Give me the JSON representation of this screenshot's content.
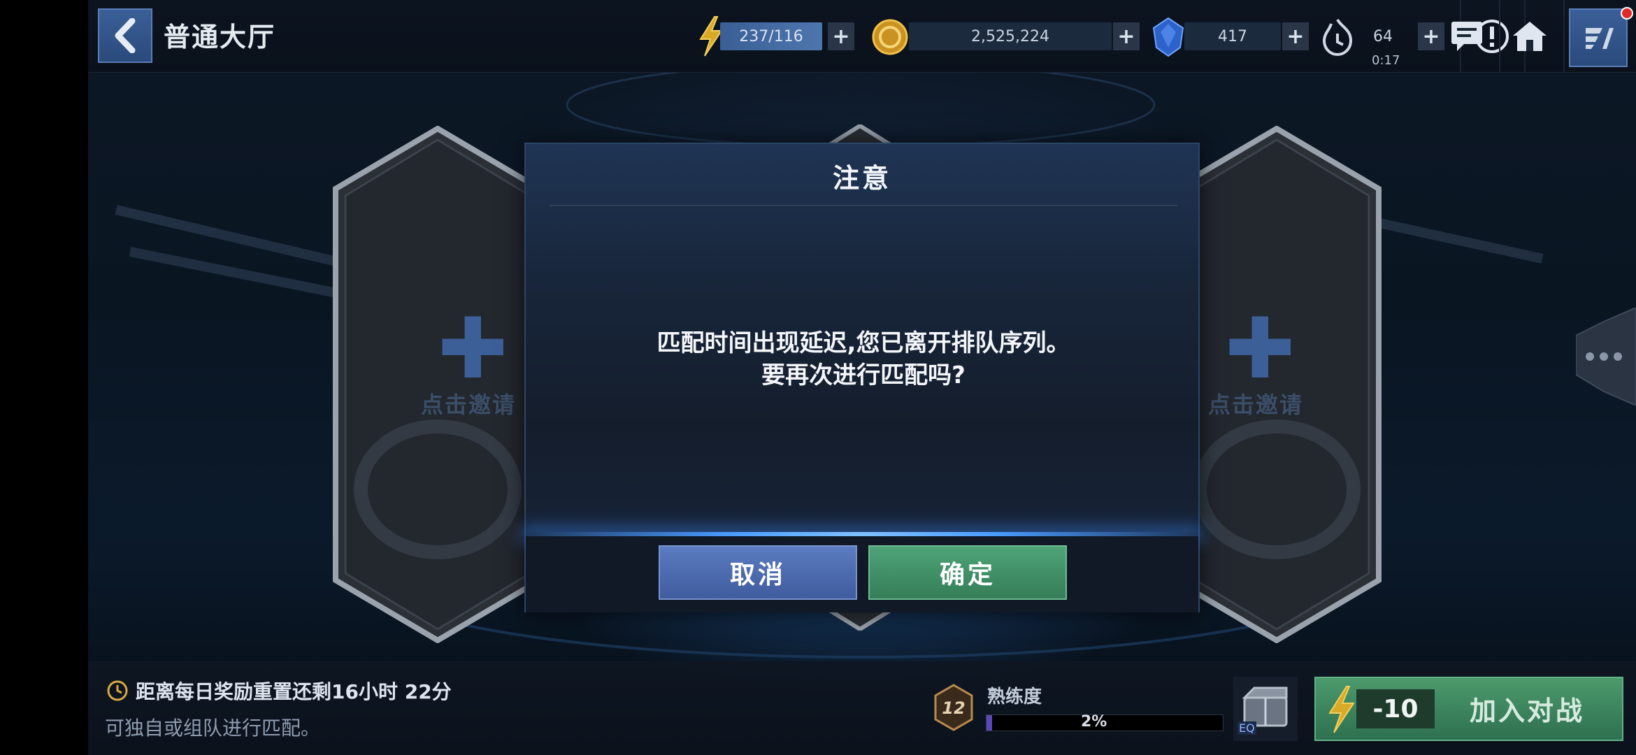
{
  "header": {
    "title": "普通大厅",
    "energy": "237/116",
    "coins": "2,525,224",
    "crystals": "417",
    "timer_value": "64",
    "timer_countdown": "0:17"
  },
  "slots": {
    "left_label": "点击邀请",
    "right_label": "点击邀请"
  },
  "dialog": {
    "title": "注意",
    "message_line1": "匹配时间出现延迟,您已离开排队序列。",
    "message_line2": "要再次进行匹配吗?",
    "cancel_label": "取消",
    "ok_label": "确定"
  },
  "footer": {
    "reset_text": "距离每日奖励重置还剩16小时 22分",
    "solo_text": "可独自或组队进行匹配。",
    "mastery_level": "12",
    "mastery_label": "熟练度",
    "mastery_percent": "2%",
    "mastery_progress": 0.02,
    "eq_label": "EQ",
    "join_cost": "-10",
    "join_label": "加入对战"
  },
  "colors": {
    "accent_blue": "#3f5c9e",
    "confirm_green": "#357e58",
    "notification_red": "#e02a2a"
  },
  "icons": [
    "back-arrow-icon",
    "lightning-icon",
    "coin-icon",
    "crystal-icon",
    "timer-flame-icon",
    "alert-icon",
    "chat-icon",
    "home-icon",
    "menu-icon",
    "clock-icon",
    "more-icon"
  ]
}
